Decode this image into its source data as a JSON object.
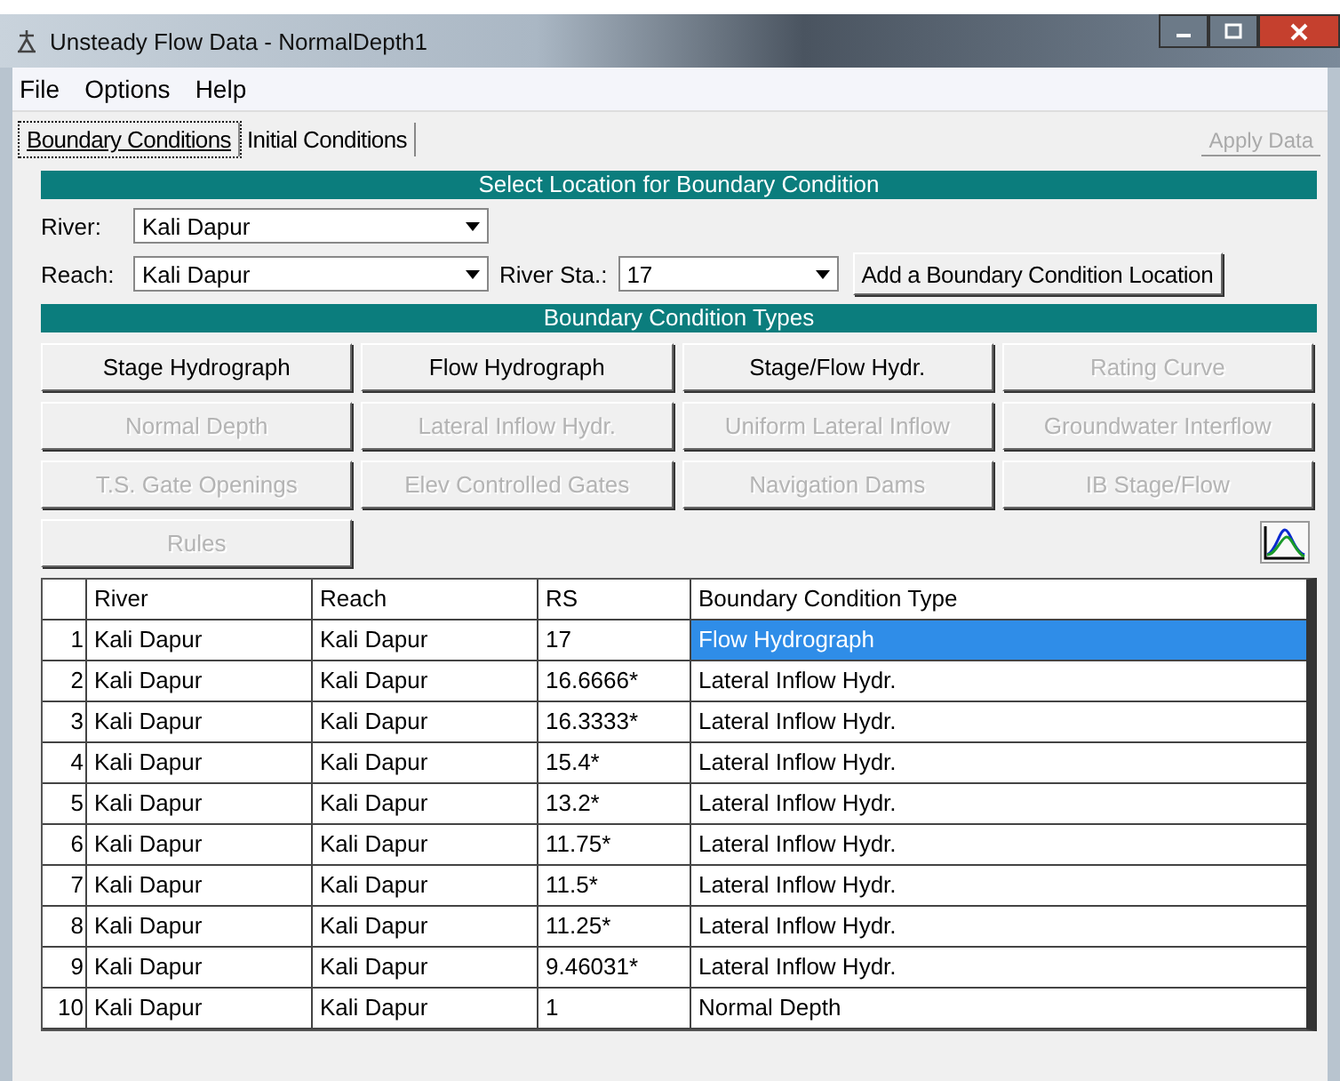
{
  "window": {
    "title": "Unsteady Flow Data - NormalDepth1"
  },
  "menu": [
    "File",
    "Options",
    "Help"
  ],
  "tabs": [
    {
      "label": "Boundary Conditions",
      "selected": true
    },
    {
      "label": "Initial Conditions",
      "selected": false
    }
  ],
  "apply_button": {
    "label": "Apply Data",
    "disabled": true
  },
  "location": {
    "header": "Select Location for Boundary Condition",
    "river_label": "River:",
    "river": "Kali Dapur",
    "reach_label": "Reach:",
    "reach": "Kali Dapur",
    "station_label": "River Sta.:",
    "station": "17",
    "add_button": "Add a Boundary Condition Location"
  },
  "types": {
    "header": "Boundary Condition Types",
    "buttons": [
      {
        "label": "Stage Hydrograph",
        "disabled": false
      },
      {
        "label": "Flow Hydrograph",
        "disabled": false
      },
      {
        "label": "Stage/Flow Hydr.",
        "disabled": false
      },
      {
        "label": "Rating Curve",
        "disabled": true
      },
      {
        "label": "Normal Depth",
        "disabled": true
      },
      {
        "label": "Lateral Inflow Hydr.",
        "disabled": true
      },
      {
        "label": "Uniform Lateral Inflow",
        "disabled": true
      },
      {
        "label": "Groundwater Interflow",
        "disabled": true
      },
      {
        "label": "T.S. Gate Openings",
        "disabled": true
      },
      {
        "label": "Elev Controlled Gates",
        "disabled": true
      },
      {
        "label": "Navigation Dams",
        "disabled": true
      },
      {
        "label": "IB Stage/Flow",
        "disabled": true
      },
      {
        "label": "Rules",
        "disabled": true
      }
    ]
  },
  "table": {
    "columns": [
      "River",
      "Reach",
      "RS",
      "Boundary Condition Type"
    ],
    "rows": [
      {
        "index": "1",
        "river": "Kali Dapur",
        "reach": "Kali Dapur",
        "rs": "17",
        "type": "Flow Hydrograph",
        "selected": true
      },
      {
        "index": "2",
        "river": "Kali Dapur",
        "reach": "Kali Dapur",
        "rs": "16.6666*",
        "type": "Lateral Inflow Hydr.",
        "selected": false
      },
      {
        "index": "3",
        "river": "Kali Dapur",
        "reach": "Kali Dapur",
        "rs": "16.3333*",
        "type": "Lateral Inflow Hydr.",
        "selected": false
      },
      {
        "index": "4",
        "river": "Kali Dapur",
        "reach": "Kali Dapur",
        "rs": "15.4*",
        "type": "Lateral Inflow Hydr.",
        "selected": false
      },
      {
        "index": "5",
        "river": "Kali Dapur",
        "reach": "Kali Dapur",
        "rs": "13.2*",
        "type": "Lateral Inflow Hydr.",
        "selected": false
      },
      {
        "index": "6",
        "river": "Kali Dapur",
        "reach": "Kali Dapur",
        "rs": "11.75*",
        "type": "Lateral Inflow Hydr.",
        "selected": false
      },
      {
        "index": "7",
        "river": "Kali Dapur",
        "reach": "Kali Dapur",
        "rs": "11.5*",
        "type": "Lateral Inflow Hydr.",
        "selected": false
      },
      {
        "index": "8",
        "river": "Kali Dapur",
        "reach": "Kali Dapur",
        "rs": "11.25*",
        "type": "Lateral Inflow Hydr.",
        "selected": false
      },
      {
        "index": "9",
        "river": "Kali Dapur",
        "reach": "Kali Dapur",
        "rs": "9.46031*",
        "type": "Lateral Inflow Hydr.",
        "selected": false
      },
      {
        "index": "10",
        "river": "Kali Dapur",
        "reach": "Kali Dapur",
        "rs": "1",
        "type": "Normal Depth",
        "selected": false
      }
    ]
  }
}
